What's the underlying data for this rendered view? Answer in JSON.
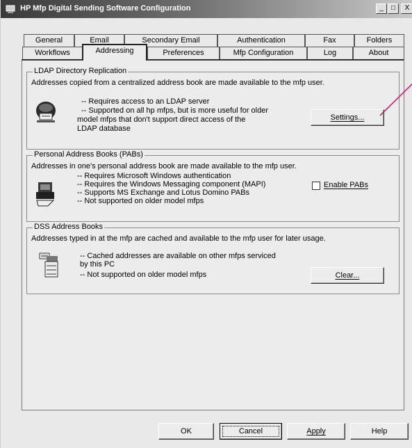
{
  "window": {
    "title": "HP Mfp Digital Sending Software Configuration",
    "minimize_glyph": "_",
    "maximize_glyph": "□",
    "close_glyph": "X"
  },
  "tabs_row1": [
    "General",
    "Email",
    "Secondary Email",
    "Authentication",
    "Fax",
    "Folders"
  ],
  "tabs_row2": [
    "Workflows",
    "Addressing",
    "Preferences",
    "Mfp Configuration",
    "Log",
    "About"
  ],
  "active_tab": "Addressing",
  "ldap": {
    "title": "LDAP Directory Replication",
    "description": "Addresses copied from a centralized address book are made available to the mfp user.",
    "bullet1": "-- Requires access to an LDAP server",
    "bullet2a": "-- Supported on all hp mfps, but is more useful for older",
    "bullet2b": "model mfps that don't support direct access of the",
    "bullet2c": "LDAP database",
    "settings_button": "Settings...",
    "icon": "ldap-server-icon"
  },
  "pab": {
    "title": "Personal Address Books (PABs)",
    "description": "Addresses in one's personal address book are made available to the mfp user.",
    "bullet1": "-- Requires Microsoft Windows authentication",
    "bullet2": "-- Requires the Windows Messaging component (MAPI)",
    "bullet3": "-- Supports MS Exchange and Lotus Domino PABs",
    "bullet4": "-- Not supported on older model mfps",
    "enable_label": "Enable PABs",
    "enable_checked": false,
    "icon": "address-book-icon"
  },
  "dss": {
    "title": "DSS Address Books",
    "description": "Addresses typed in at the mfp are cached and available to the mfp user for later usage.",
    "bullet1a": "-- Cached addresses are available on other mfps serviced",
    "bullet1b": "by this PC",
    "bullet2": "-- Not supported on older model mfps",
    "clear_button": "Clear...",
    "icon": "mfp-device-icon"
  },
  "footer": {
    "ok": "OK",
    "cancel": "Cancel",
    "apply": "Apply",
    "help": "Help"
  },
  "colors": {
    "annotation_pointer": "#d0207a"
  }
}
